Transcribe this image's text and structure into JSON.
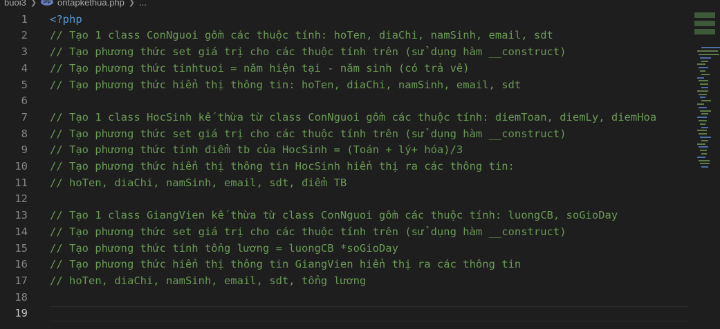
{
  "breadcrumb": {
    "folder": "buoi3",
    "file": "ontapkethua.php",
    "ellipsis": "..."
  },
  "editor": {
    "lines": [
      {
        "n": "1",
        "text": "<?php"
      },
      {
        "n": "2",
        "text": "// Tạo 1 class ConNguoi gồm các thuộc tính: hoTen, diaChi, namSinh, email, sdt"
      },
      {
        "n": "3",
        "text": "// Tạo phương thức set giá trị cho các thuộc tính trên (sử dụng hàm __construct)"
      },
      {
        "n": "4",
        "text": "// Tạo phương thức tinhtuoi = năm hiện tại - năm sinh (có trả về)"
      },
      {
        "n": "5",
        "text": "// Tạo phương thức hiển thị thông tin: hoTen, diaChi, namSinh, email, sdt"
      },
      {
        "n": "6",
        "text": ""
      },
      {
        "n": "7",
        "text": "// Tạo 1 class HocSinh kế thừa từ class ConNguoi gồm các thuộc tính: diemToan, diemLy, diemHoa"
      },
      {
        "n": "8",
        "text": "// Tạo phương thức set giá trị cho các thuộc tính trên (sử dụng hàm __construct)"
      },
      {
        "n": "9",
        "text": "// Tạo phương thức tính điểm tb của HocSinh = (Toán + lý+ hóa)/3"
      },
      {
        "n": "10",
        "text": "// Tạo phương thức hiển thị thông tin HocSinh hiển thị ra các thông tin:"
      },
      {
        "n": "11",
        "text": "// hoTen, diaChi, namSinh, email, sdt, điểm TB"
      },
      {
        "n": "12",
        "text": ""
      },
      {
        "n": "13",
        "text": "// Tạo 1 class GiangVien kế thừa từ class ConNguoi gồm các thuộc tính: luongCB, soGioDay"
      },
      {
        "n": "14",
        "text": "// Tạo phương thức set giá trị cho các thuộc tính trên (sử dụng hàm __construct)"
      },
      {
        "n": "15",
        "text": "// Tạo phương thức tính tổng lương = luongCB *soGioDay"
      },
      {
        "n": "16",
        "text": "// Tạo phương thức hiển thị thông tin GiangVien hiển thị ra các thông tin"
      },
      {
        "n": "17",
        "text": "// hoTen, diaChi, namSinh, email, sdt, tổng lương"
      },
      {
        "n": "18",
        "text": ""
      },
      {
        "n": "19",
        "text": ""
      }
    ],
    "active_line": "19"
  },
  "colors": {
    "background": "#1e1e1e",
    "comment": "#6a9955",
    "keyword": "#569cd6",
    "line_number": "#858585"
  },
  "icons": {
    "file_icon": "php-file-icon",
    "separator": "chevron-right-icon"
  }
}
